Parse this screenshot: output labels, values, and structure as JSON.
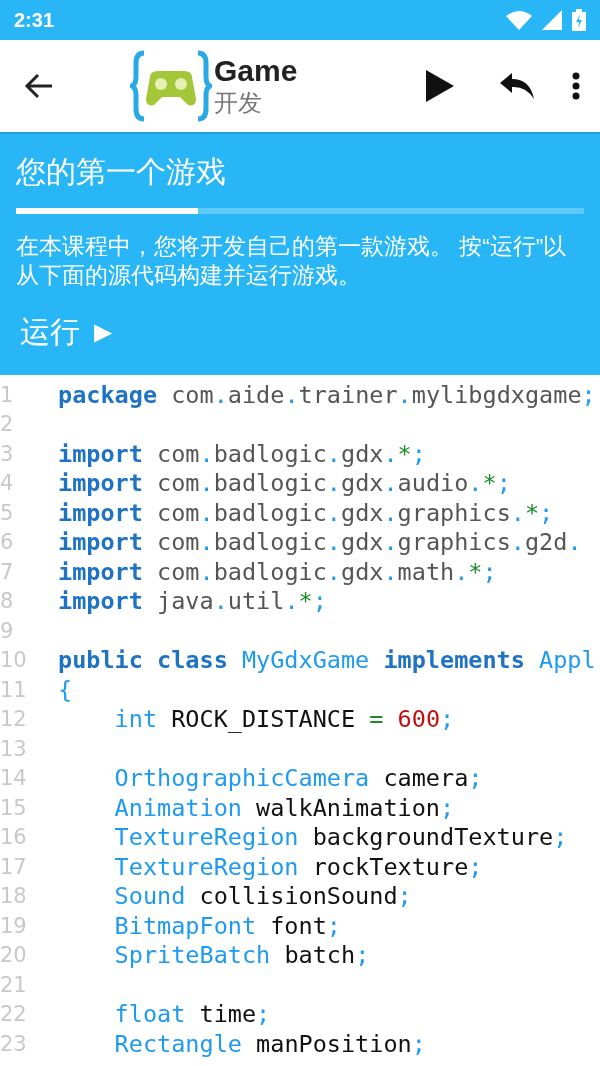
{
  "status_bar": {
    "time": "2:31"
  },
  "toolbar": {
    "title": "Game",
    "subtitle": "开发"
  },
  "lesson": {
    "title": "您的第一个游戏",
    "progress": {
      "level": 0.32
    },
    "description": "在本课程中，您将开发自己的第一款游戏。 按“运行”以从下面的源代码构建并运行游戏。",
    "run_link": "运行 ►"
  },
  "code": {
    "lines": [
      {
        "number": "1",
        "tokens": [
          {
            "text": "package",
            "kind": "keyword"
          },
          {
            "text": " com",
            "kind": "name"
          },
          {
            "text": ".",
            "kind": "punct"
          },
          {
            "text": "aide",
            "kind": "name"
          },
          {
            "text": ".",
            "kind": "punct"
          },
          {
            "text": "trainer",
            "kind": "name"
          },
          {
            "text": ".",
            "kind": "punct"
          },
          {
            "text": "mylibgdxgame",
            "kind": "name"
          },
          {
            "text": ";",
            "kind": "punct"
          }
        ]
      },
      {
        "number": "2"
      },
      {
        "number": "3",
        "tokens": [
          {
            "text": "import",
            "kind": "keyword"
          },
          {
            "text": " com",
            "kind": "name"
          },
          {
            "text": ".",
            "kind": "punct"
          },
          {
            "text": "badlogic",
            "kind": "name"
          },
          {
            "text": ".",
            "kind": "punct"
          },
          {
            "text": "gdx",
            "kind": "name"
          },
          {
            "text": ".",
            "kind": "punct"
          },
          {
            "text": "*",
            "kind": "op"
          },
          {
            "text": ";",
            "kind": "punct"
          }
        ]
      },
      {
        "number": "4",
        "tokens": [
          {
            "text": "import",
            "kind": "keyword"
          },
          {
            "text": " com",
            "kind": "name"
          },
          {
            "text": ".",
            "kind": "punct"
          },
          {
            "text": "badlogic",
            "kind": "name"
          },
          {
            "text": ".",
            "kind": "punct"
          },
          {
            "text": "gdx",
            "kind": "name"
          },
          {
            "text": ".",
            "kind": "punct"
          },
          {
            "text": "audio",
            "kind": "name"
          },
          {
            "text": ".",
            "kind": "punct"
          },
          {
            "text": "*",
            "kind": "op"
          },
          {
            "text": ";",
            "kind": "punct"
          }
        ]
      },
      {
        "number": "5",
        "tokens": [
          {
            "text": "import",
            "kind": "keyword"
          },
          {
            "text": " com",
            "kind": "name"
          },
          {
            "text": ".",
            "kind": "punct"
          },
          {
            "text": "badlogic",
            "kind": "name"
          },
          {
            "text": ".",
            "kind": "punct"
          },
          {
            "text": "gdx",
            "kind": "name"
          },
          {
            "text": ".",
            "kind": "punct"
          },
          {
            "text": "graphics",
            "kind": "name"
          },
          {
            "text": ".",
            "kind": "punct"
          },
          {
            "text": "*",
            "kind": "op"
          },
          {
            "text": ";",
            "kind": "punct"
          }
        ]
      },
      {
        "number": "6",
        "tokens": [
          {
            "text": "import",
            "kind": "keyword"
          },
          {
            "text": " com",
            "kind": "name"
          },
          {
            "text": ".",
            "kind": "punct"
          },
          {
            "text": "badlogic",
            "kind": "name"
          },
          {
            "text": ".",
            "kind": "punct"
          },
          {
            "text": "gdx",
            "kind": "name"
          },
          {
            "text": ".",
            "kind": "punct"
          },
          {
            "text": "graphics",
            "kind": "name"
          },
          {
            "text": ".",
            "kind": "punct"
          },
          {
            "text": "g2d",
            "kind": "name"
          },
          {
            "text": ".",
            "kind": "punct"
          }
        ]
      },
      {
        "number": "7",
        "tokens": [
          {
            "text": "import",
            "kind": "keyword"
          },
          {
            "text": " com",
            "kind": "name"
          },
          {
            "text": ".",
            "kind": "punct"
          },
          {
            "text": "badlogic",
            "kind": "name"
          },
          {
            "text": ".",
            "kind": "punct"
          },
          {
            "text": "gdx",
            "kind": "name"
          },
          {
            "text": ".",
            "kind": "punct"
          },
          {
            "text": "math",
            "kind": "name"
          },
          {
            "text": ".",
            "kind": "punct"
          },
          {
            "text": "*",
            "kind": "op"
          },
          {
            "text": ";",
            "kind": "punct"
          }
        ]
      },
      {
        "number": "8",
        "tokens": [
          {
            "text": "import",
            "kind": "keyword"
          },
          {
            "text": " java",
            "kind": "name"
          },
          {
            "text": ".",
            "kind": "punct"
          },
          {
            "text": "util",
            "kind": "name"
          },
          {
            "text": ".",
            "kind": "punct"
          },
          {
            "text": "*",
            "kind": "op"
          },
          {
            "text": ";",
            "kind": "punct"
          }
        ]
      },
      {
        "number": "9"
      },
      {
        "number": "10",
        "tokens": [
          {
            "text": "public class",
            "kind": "keyword"
          },
          {
            "text": " MyGdxGame",
            "kind": "type"
          },
          {
            "text": " implements",
            "kind": "keyword"
          },
          {
            "text": " Appl",
            "kind": "type"
          }
        ]
      },
      {
        "number": "11",
        "tokens": [
          {
            "text": "{",
            "kind": "punct"
          }
        ]
      },
      {
        "number": "12",
        "tokens": [
          {
            "text": "    int",
            "kind": "type"
          },
          {
            "text": " ROCK_DISTANCE ",
            "kind": "ident"
          },
          {
            "text": "=",
            "kind": "op"
          },
          {
            "text": " 600",
            "kind": "number"
          },
          {
            "text": ";",
            "kind": "punct"
          }
        ]
      },
      {
        "number": "13"
      },
      {
        "number": "14",
        "tokens": [
          {
            "text": "    OrthographicCamera",
            "kind": "type"
          },
          {
            "text": " camera",
            "kind": "ident"
          },
          {
            "text": ";",
            "kind": "punct"
          }
        ]
      },
      {
        "number": "15",
        "tokens": [
          {
            "text": "    Animation",
            "kind": "type"
          },
          {
            "text": " walkAnimation",
            "kind": "ident"
          },
          {
            "text": ";",
            "kind": "punct"
          }
        ]
      },
      {
        "number": "16",
        "tokens": [
          {
            "text": "    TextureRegion",
            "kind": "type"
          },
          {
            "text": " backgroundTexture",
            "kind": "ident"
          },
          {
            "text": ";",
            "kind": "punct"
          }
        ]
      },
      {
        "number": "17",
        "tokens": [
          {
            "text": "    TextureRegion",
            "kind": "type"
          },
          {
            "text": " rockTexture",
            "kind": "ident"
          },
          {
            "text": ";",
            "kind": "punct"
          }
        ]
      },
      {
        "number": "18",
        "tokens": [
          {
            "text": "    Sound",
            "kind": "type"
          },
          {
            "text": " collisionSound",
            "kind": "ident"
          },
          {
            "text": ";",
            "kind": "punct"
          }
        ]
      },
      {
        "number": "19",
        "tokens": [
          {
            "text": "    BitmapFont",
            "kind": "type"
          },
          {
            "text": " font",
            "kind": "ident"
          },
          {
            "text": ";",
            "kind": "punct"
          }
        ]
      },
      {
        "number": "20",
        "tokens": [
          {
            "text": "    SpriteBatch",
            "kind": "type"
          },
          {
            "text": " batch",
            "kind": "ident"
          },
          {
            "text": ";",
            "kind": "punct"
          }
        ]
      },
      {
        "number": "21"
      },
      {
        "number": "22",
        "tokens": [
          {
            "text": "    float",
            "kind": "type"
          },
          {
            "text": " time",
            "kind": "ident"
          },
          {
            "text": ";",
            "kind": "punct"
          }
        ]
      },
      {
        "number": "23",
        "tokens": [
          {
            "text": "    Rectangle",
            "kind": "type"
          },
          {
            "text": " manPosition",
            "kind": "ident"
          },
          {
            "text": ";",
            "kind": "punct"
          }
        ]
      }
    ]
  }
}
